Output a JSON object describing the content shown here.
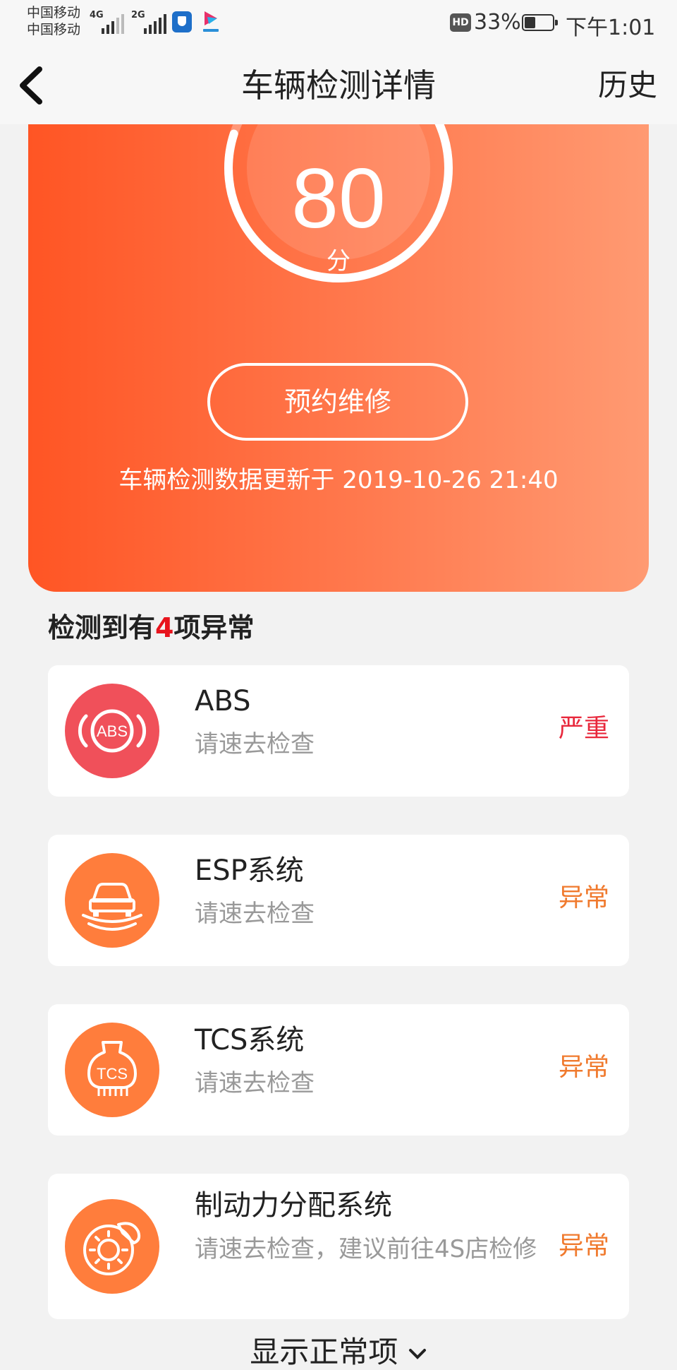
{
  "status_bar": {
    "carrier_1": "中国移动",
    "carrier_2": "中国移动",
    "network_1": "4G",
    "network_2": "2G",
    "hd_badge": "HD",
    "battery": "33%",
    "time": "下午1:01",
    "icons": [
      "signal-icon",
      "shield-icon",
      "video-app-icon",
      "battery-icon"
    ]
  },
  "nav": {
    "title": "车辆检测详情",
    "history": "历史",
    "back_icon": "chevron-left-icon"
  },
  "hero": {
    "score": "80",
    "score_unit": "分",
    "book_repair": "预约维修",
    "update_text": "车辆检测数据更新于 2019-10-26 21:40",
    "gradient_start": "#ff5524",
    "gradient_end": "#ff9a72"
  },
  "section": {
    "prefix": "检测到有",
    "count": "4",
    "suffix": "项异常"
  },
  "issues": [
    {
      "name": "ABS",
      "desc": "请速去检查",
      "level": "严重",
      "level_color": "#e8283c",
      "icon": "abs-icon",
      "icon_label": "ABS",
      "icon_color": "#f0505a"
    },
    {
      "name": "ESP系统",
      "desc": "请速去检查",
      "level": "异常",
      "level_color": "#f07a2e",
      "icon": "esp-car-icon",
      "icon_color": "#ff7d3c"
    },
    {
      "name": "TCS系统",
      "desc": "请速去检查",
      "level": "异常",
      "level_color": "#f07a2e",
      "icon": "tcs-icon",
      "icon_label": "TCS",
      "icon_color": "#ff7d3c"
    },
    {
      "name": "制动力分配系统",
      "desc": "请速去检查，建议前往4S店检修",
      "level": "异常",
      "level_color": "#f07a2e",
      "icon": "brake-disc-icon",
      "icon_color": "#ff7d3c"
    }
  ],
  "footer": {
    "show_normal": "显示正常项"
  }
}
